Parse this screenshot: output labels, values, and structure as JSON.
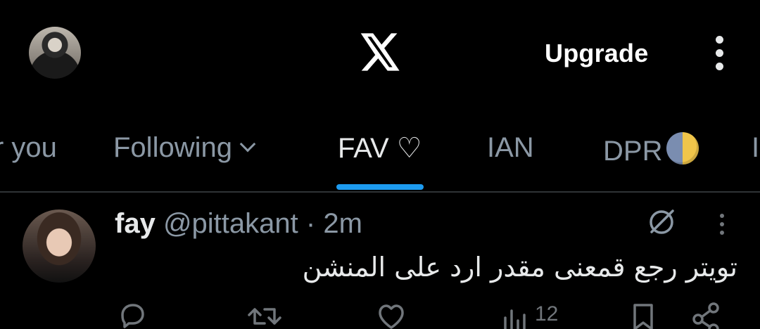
{
  "header": {
    "upgrade_label": "Upgrade",
    "logo": "x-logo"
  },
  "tabs": [
    {
      "label": "r you",
      "active": false
    },
    {
      "label": "Following",
      "active": false,
      "has_chevron": true
    },
    {
      "label": "FAV ♡",
      "active": true
    },
    {
      "label": "IAN",
      "active": false
    },
    {
      "label": "DPR",
      "active": false,
      "emoji": "moon-icon"
    },
    {
      "label": "I",
      "active": false
    }
  ],
  "tweet": {
    "name": "fay",
    "handle": "@pittakant",
    "separator": "·",
    "time": "2m",
    "text": "تويتر رجع قمعنى مقدر ارد على المنشن",
    "views": "12"
  },
  "colors": {
    "background": "#000000",
    "accent": "#1d9bf0",
    "muted": "#8b98a5",
    "text": "#e7e9ea"
  }
}
